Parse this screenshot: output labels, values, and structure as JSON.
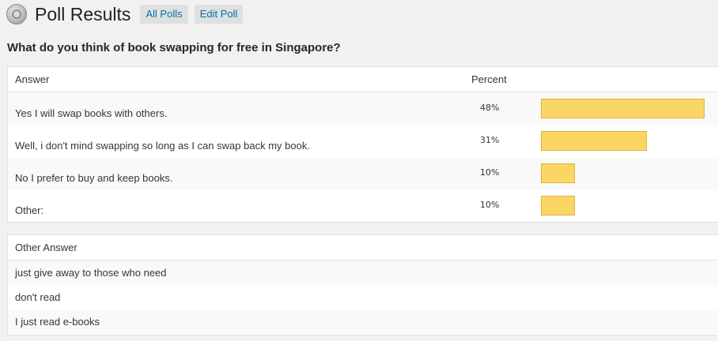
{
  "header": {
    "title": "Poll Results",
    "buttons": {
      "all_polls": "All Polls",
      "edit_poll": "Edit Poll"
    }
  },
  "question": "What do you think of book swapping for free in Singapore?",
  "results_table": {
    "headers": {
      "answer": "Answer",
      "percent": "Percent",
      "bar": ""
    },
    "rows": [
      {
        "answer": "Yes I will swap books with others.",
        "percent_label": "48%",
        "percent": 48
      },
      {
        "answer": "Well, i don't mind swapping so long as I can swap back my book.",
        "percent_label": "31%",
        "percent": 31
      },
      {
        "answer": "No I prefer to buy and keep books.",
        "percent_label": "10%",
        "percent": 10
      },
      {
        "answer": "Other:",
        "percent_label": "10%",
        "percent": 10
      }
    ],
    "bar_color": "#fcd664"
  },
  "other_table": {
    "header": "Other Answer",
    "rows": [
      "just give away to those who need",
      "don't read",
      "I just read e-books"
    ]
  }
}
